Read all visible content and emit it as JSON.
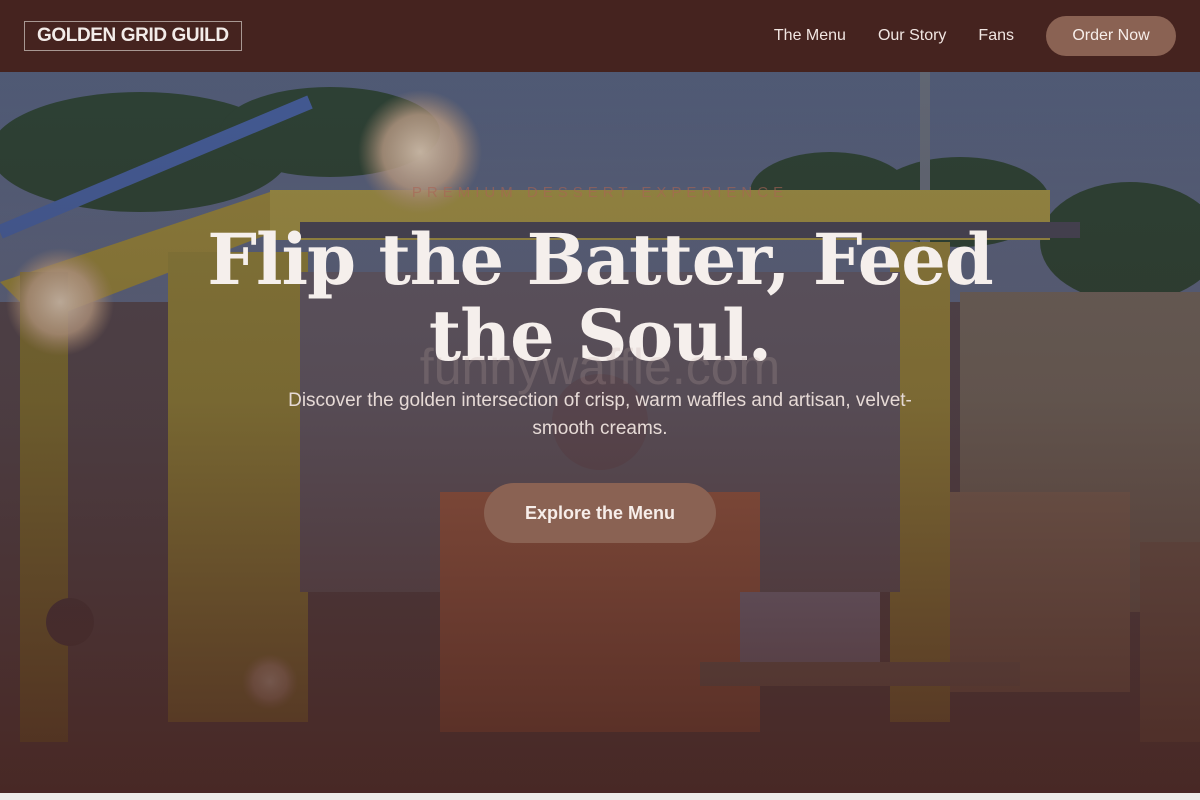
{
  "brand": {
    "name": "GOLDEN GRID GUILD"
  },
  "nav": {
    "links": [
      {
        "label": "The Menu"
      },
      {
        "label": "Our Story"
      },
      {
        "label": "Fans"
      }
    ],
    "cta_label": "Order Now"
  },
  "hero": {
    "eyebrow": "PREMIUM DESSERT EXPERIENCE",
    "headline": "Flip the Batter, Feed the Soul.",
    "subtext": "Discover the golden intersection of crisp, warm waffles and artisan, velvet-smooth creams.",
    "cta_label": "Explore the Menu",
    "watermark": "funnywaffle.com"
  },
  "colors": {
    "nav_bg": "#45231f",
    "accent": "#8a6253",
    "headline": "#f5efec"
  }
}
